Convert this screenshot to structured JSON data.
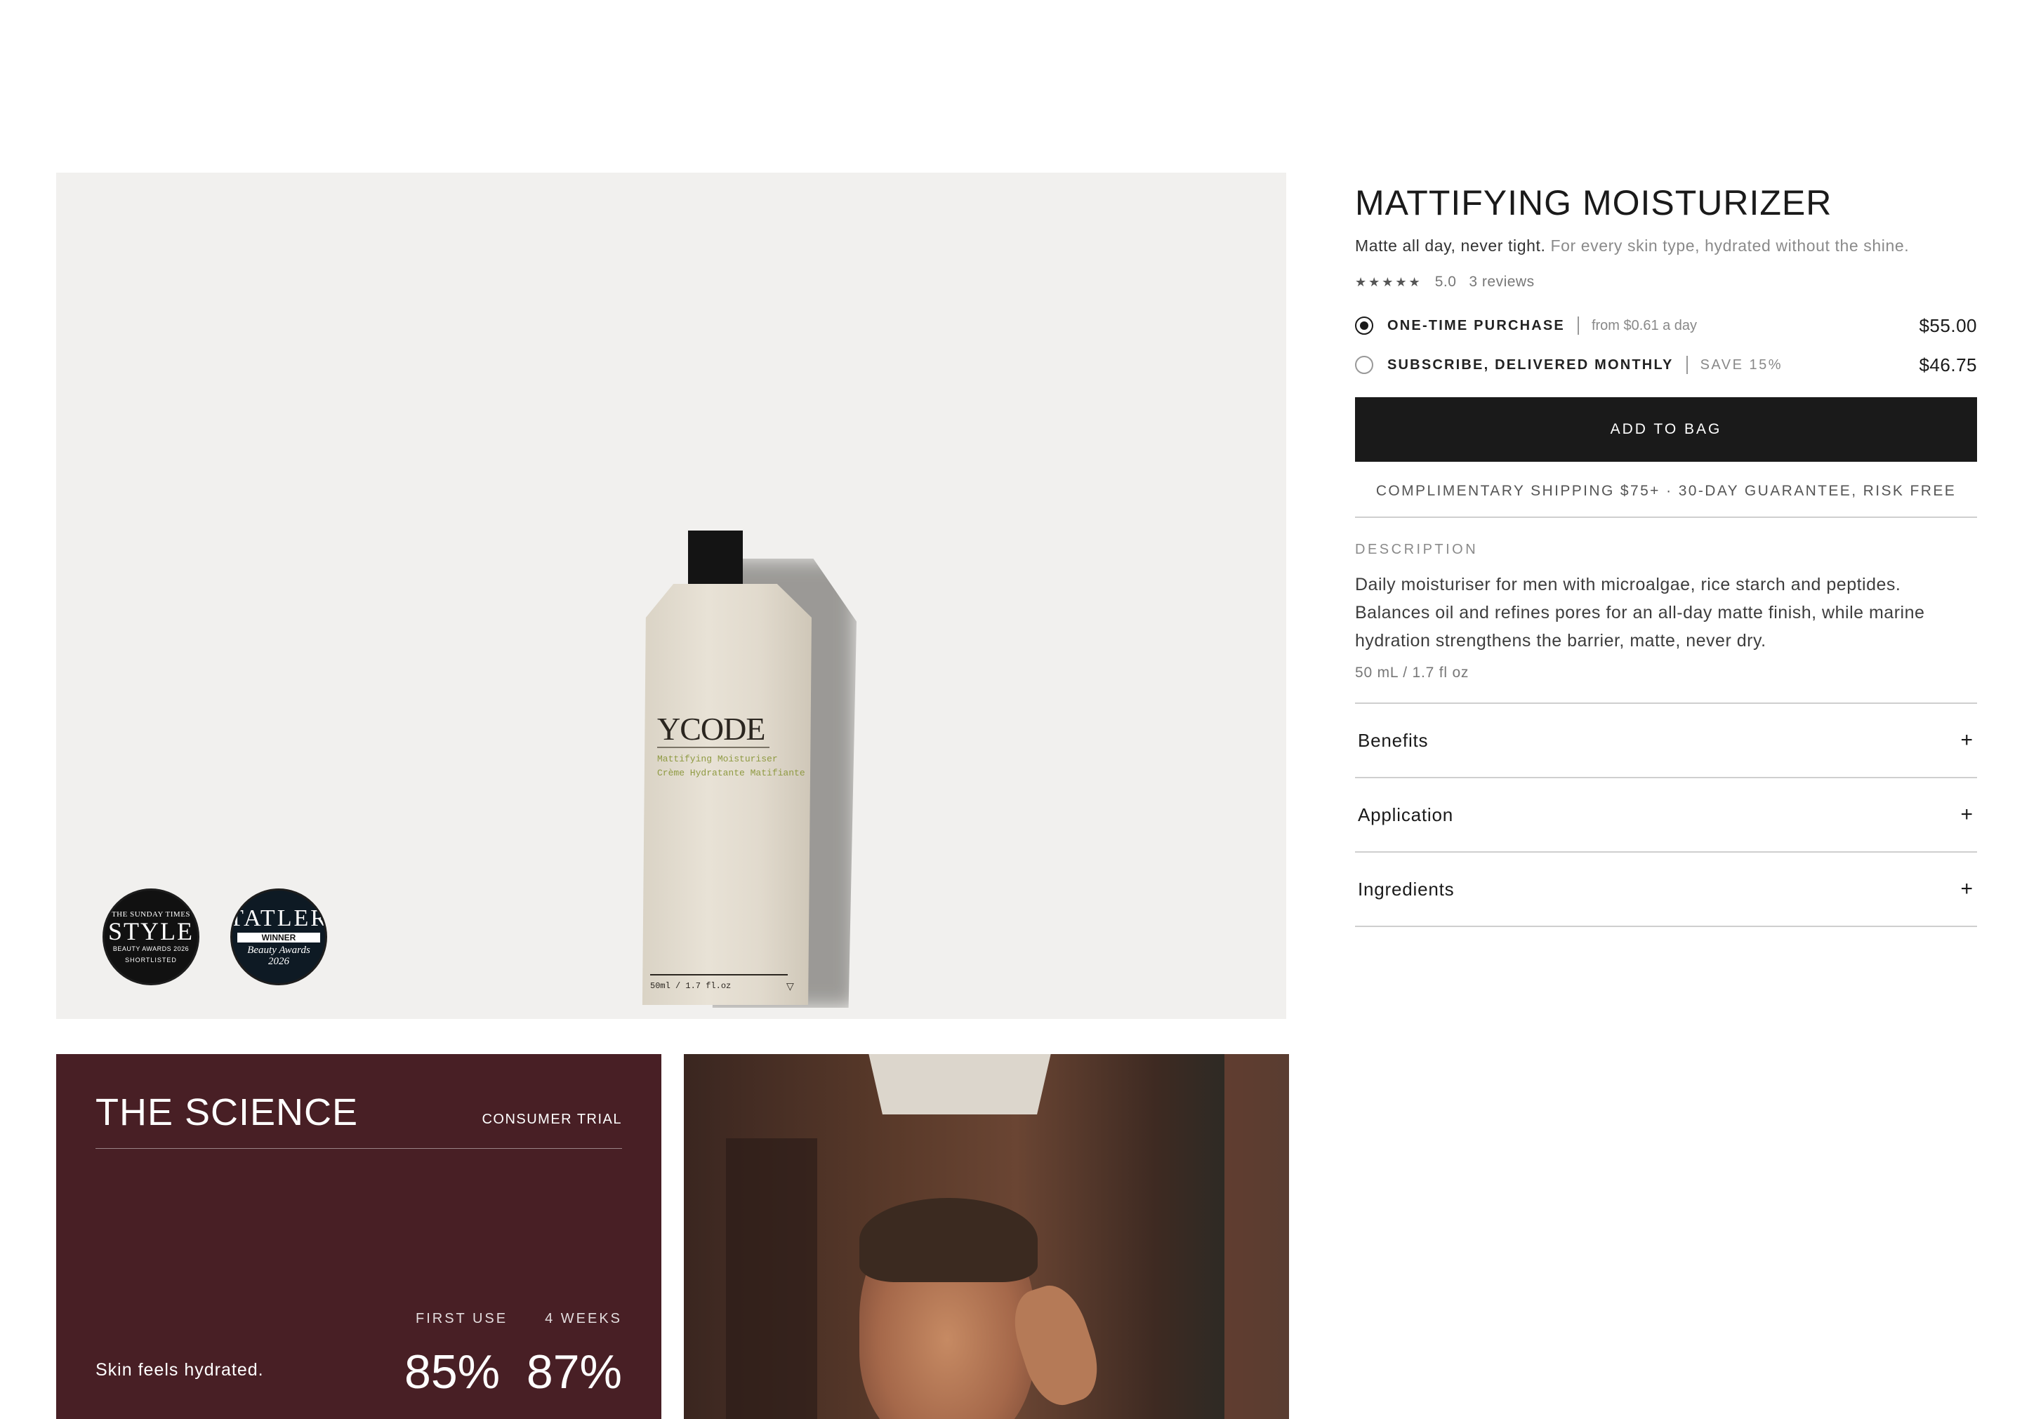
{
  "product": {
    "image": {
      "tube_brand": "YCODE",
      "tube_line1": "Mattifying Moisturiser",
      "tube_line2": "Crème Hydratante Matifiante",
      "tube_size": "50ml / 1.7 fl.oz"
    },
    "awards": [
      {
        "l1": "THE SUNDAY TIMES",
        "l2": "STYLE",
        "l3": "BEAUTY AWARDS 2026",
        "l4": "SHORTLISTED"
      },
      {
        "l1": "TATLER",
        "l2": "WINNER",
        "l3": "Beauty Awards",
        "l4": "2026"
      }
    ],
    "title": "MATTIFYING MOISTURIZER",
    "tagline_strong": "Matte all day, never tight.",
    "tagline_soft": "For every skin type, hydrated without the shine.",
    "rating": {
      "stars": "★★★★★",
      "score": "5.0",
      "reviews": "3 reviews"
    },
    "options": [
      {
        "label": "ONE-TIME PURCHASE",
        "note": "from $0.61 a day",
        "price": "$55.00",
        "selected": true
      },
      {
        "label": "SUBSCRIBE, DELIVERED MONTHLY",
        "note": "SAVE 15%",
        "price": "$46.75",
        "selected": false
      }
    ],
    "add_to_bag": "ADD TO BAG",
    "shipping": "COMPLIMENTARY SHIPPING $75+ · 30-DAY GUARANTEE, RISK FREE",
    "description_heading": "DESCRIPTION",
    "description": "Daily moisturiser for men with microalgae, rice starch and peptides. Balances oil and refines pores for an all-day matte finish, while marine hydration strengthens the barrier, matte, never dry.",
    "size": "50 mL / 1.7 fl oz",
    "accordion": [
      {
        "label": "Benefits",
        "icon": "+"
      },
      {
        "label": "Application",
        "icon": "+"
      },
      {
        "label": "Ingredients",
        "icon": "+"
      }
    ]
  },
  "science": {
    "title": "THE SCIENCE",
    "tag": "CONSUMER TRIAL",
    "col1": "FIRST USE",
    "col2": "4 WEEKS",
    "claim": "Skin feels hydrated.",
    "val1": "85%",
    "val2": "87%"
  },
  "colors": {
    "science_bg": "#481f25",
    "button_bg": "#1a1a1a",
    "hero_bg": "#f1f0ee"
  }
}
